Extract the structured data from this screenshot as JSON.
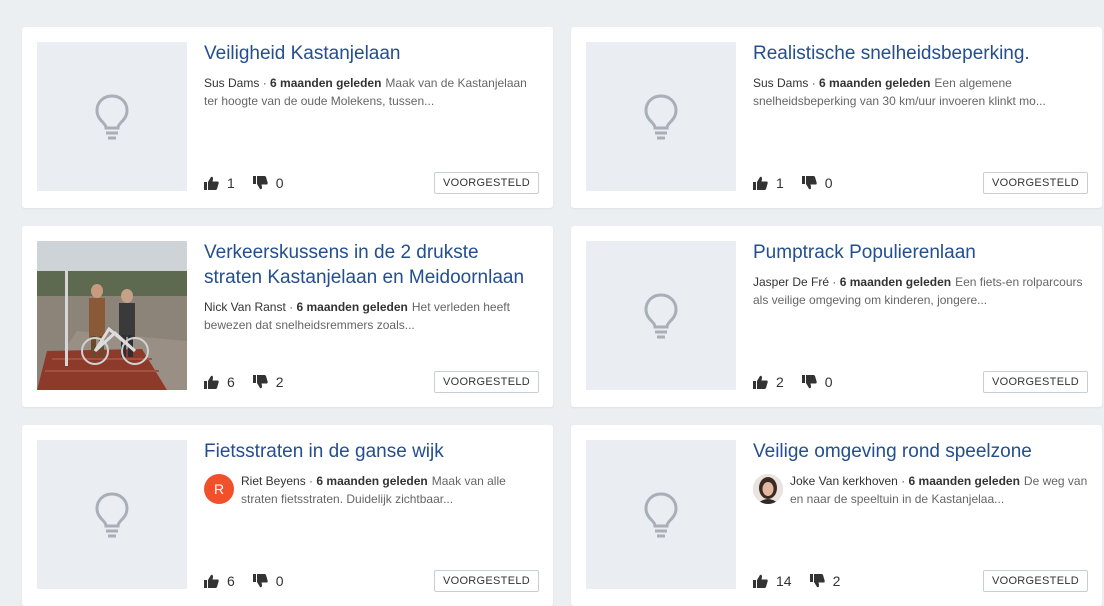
{
  "ideas": [
    {
      "title": "Veiligheid Kastanjelaan",
      "author": "Sus Dams",
      "time": "6 maanden geleden",
      "snippet": "Maak van de Kastanjelaan ter hoogte van de oude Molekens, tussen...",
      "upvotes": "1",
      "downvotes": "0",
      "status": "VOORGESTELD",
      "image": "lightbulb-icon"
    },
    {
      "title": "Realistische snelheidsbeperking.",
      "author": "Sus Dams",
      "time": "6 maanden geleden",
      "snippet": "Een algemene snelheidsbeperking van 30 km/uur invoeren klinkt mo...",
      "upvotes": "1",
      "downvotes": "0",
      "status": "VOORGESTELD",
      "image": "lightbulb-icon"
    },
    {
      "title": "Verkeerskussens in de 2 drukste straten Kastanjelaan en Meidoornlaan",
      "author": "Nick Van Ranst",
      "time": "6 maanden geleden",
      "snippet": "Het verleden heeft bewezen dat snelheidsremmers zoals...",
      "upvotes": "6",
      "downvotes": "2",
      "status": "VOORGESTELD",
      "image": "street-photo"
    },
    {
      "title": "Pumptrack Populierenlaan",
      "author": "Jasper De Fré",
      "time": "6 maanden geleden",
      "snippet": "Een fiets-en rolparcours als veilige omgeving om kinderen, jongere...",
      "upvotes": "2",
      "downvotes": "0",
      "status": "VOORGESTELD",
      "image": "lightbulb-icon"
    },
    {
      "title": "Fietsstraten in de ganse wijk",
      "author": "Riet Beyens",
      "avatar_letter": "R",
      "time": "6 maanden geleden",
      "snippet": "Maak van alle straten fietsstraten. Duidelijk zichtbaar...",
      "upvotes": "6",
      "downvotes": "0",
      "status": "VOORGESTELD",
      "image": "lightbulb-icon"
    },
    {
      "title": "Veilige omgeving rond speelzone",
      "author": "Joke Van kerkhoven",
      "time": "6 maanden geleden",
      "snippet": "De weg van en naar de speeltuin in de Kastanjelaa...",
      "upvotes": "14",
      "downvotes": "2",
      "status": "VOORGESTELD",
      "image": "lightbulb-icon"
    }
  ],
  "separator": "·",
  "colors": {
    "title": "#234e8f",
    "placeholder_bg": "#eaedf1",
    "icon_gray": "#a9afb7",
    "avatar_orange": "#f0502a",
    "page_bg": "#eceff2"
  }
}
